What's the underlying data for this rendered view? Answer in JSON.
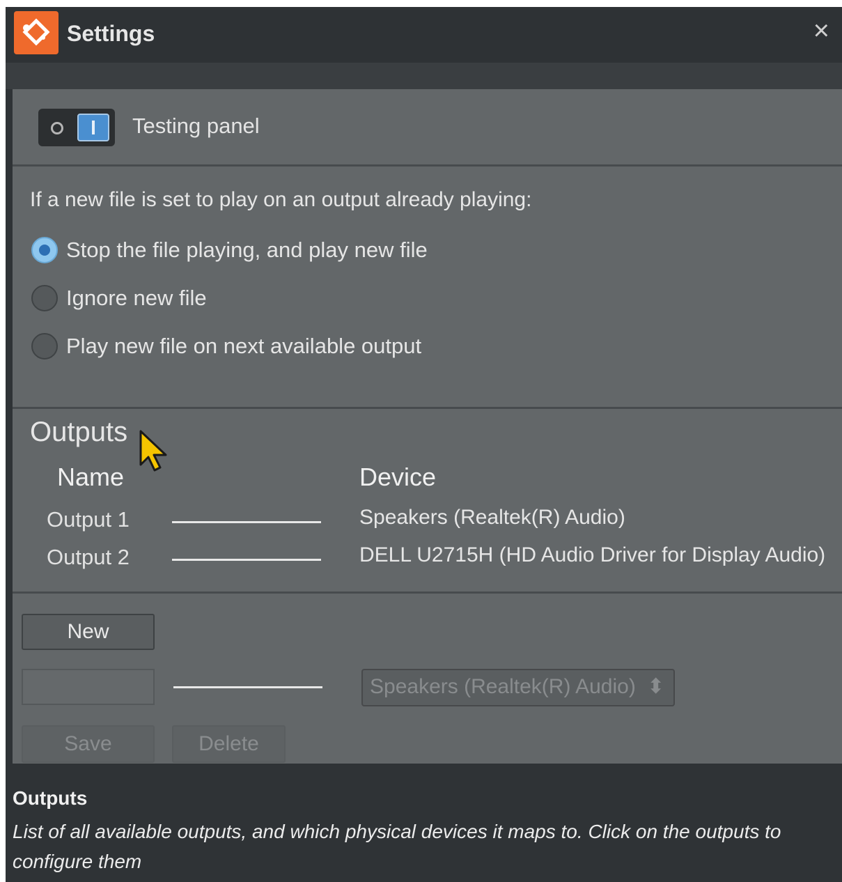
{
  "window": {
    "title": "Settings",
    "close_symbol": "×",
    "app_icon": "app-logo-icon",
    "accent_color": "#ef6a2c"
  },
  "testing_panel": {
    "label": "Testing panel",
    "toggle_on": true
  },
  "playback": {
    "question": "If a new file is set to play on an output already playing:",
    "options": [
      {
        "label": "Stop the file playing, and play new file",
        "selected": true
      },
      {
        "label": "Ignore new file",
        "selected": false
      },
      {
        "label": "Play new file on next available output",
        "selected": false
      }
    ]
  },
  "outputs": {
    "title": "Outputs",
    "columns": {
      "name": "Name",
      "device": "Device"
    },
    "rows": [
      {
        "name": "Output 1",
        "device": "Speakers (Realtek(R) Audio)"
      },
      {
        "name": "Output 2",
        "device": "DELL U2715H (HD Audio Driver for Display Audio)"
      }
    ],
    "new_button": "New",
    "name_input_value": "",
    "device_select_value": "Speakers (Realtek(R) Audio)",
    "select_arrows": "⬍",
    "save_button": "Save",
    "delete_button": "Delete"
  },
  "help": {
    "title": "Outputs",
    "text": "List of all available outputs, and which physical devices it maps to. Click on the outputs to configure them"
  }
}
